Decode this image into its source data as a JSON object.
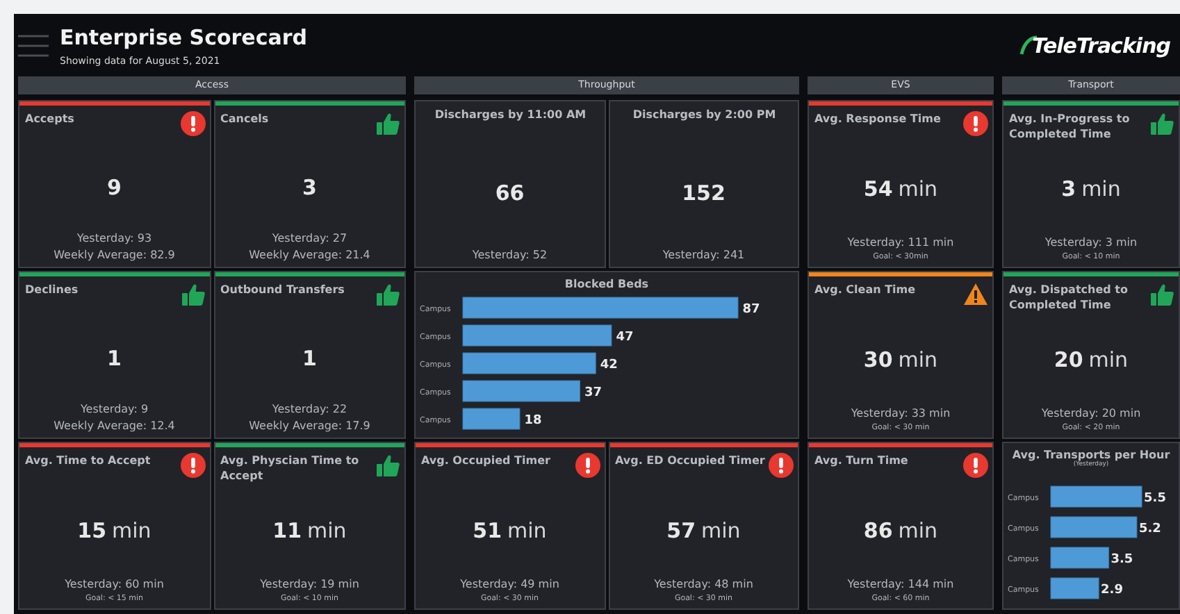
{
  "header": {
    "title": "Enterprise Scorecard",
    "subtitle": "Showing data for August 5, 2021",
    "logo": "TeleTracking"
  },
  "sections": [
    {
      "title": "Access",
      "cards": [
        {
          "kind": "kpi",
          "title": "Accepts",
          "color": "#e8382f",
          "value": "9",
          "lines": [
            {
              "kind": "main",
              "text": "Yesterday: 93"
            },
            {
              "kind": "main",
              "text": "Weekly Average: 82.9"
            }
          ]
        },
        {
          "kind": "kpi",
          "title": "Cancels",
          "color": "#21a559",
          "value": "3",
          "lines": [
            {
              "kind": "main",
              "text": "Yesterday: 27"
            },
            {
              "kind": "main",
              "text": "Weekly Average: 21.4"
            }
          ]
        },
        {
          "kind": "kpi",
          "title": "Declines",
          "color": "#21a559",
          "value": "1",
          "lines": [
            {
              "kind": "main",
              "text": "Yesterday: 9"
            },
            {
              "kind": "main",
              "text": "Weekly Average: 12.4"
            }
          ]
        },
        {
          "kind": "kpi",
          "title": "Outbound Transfers",
          "color": "#21a559",
          "value": "1",
          "lines": [
            {
              "kind": "main",
              "text": "Yesterday: 22"
            },
            {
              "kind": "main",
              "text": "Weekly Average: 17.9"
            }
          ]
        },
        {
          "kind": "kpi",
          "title": "Avg. Time to Accept",
          "color": "#e8382f",
          "value": "15",
          "unit": "min",
          "lines": [
            {
              "kind": "main",
              "text": "Yesterday: 60 min"
            },
            {
              "kind": "goal",
              "text": "Goal: < 15 min"
            }
          ]
        },
        {
          "kind": "kpi",
          "title": "Avg. Physcian Time to Accept",
          "color": "#21a559",
          "value": "11",
          "unit": "min",
          "lines": [
            {
              "kind": "main",
              "text": "Yesterday: 19 min"
            },
            {
              "kind": "goal",
              "text": "Goal: < 10 min"
            }
          ]
        }
      ]
    },
    {
      "title": "Throughput",
      "cards": [
        {
          "kind": "kpi",
          "title": "Discharges by 11:00 AM",
          "value": "66",
          "lines": [
            {
              "kind": "main",
              "text": "Yesterday: 52"
            }
          ]
        },
        {
          "kind": "kpi",
          "title": "Discharges by 2:00 PM",
          "value": "152",
          "lines": [
            {
              "kind": "main",
              "text": "Yesterday: 241"
            }
          ]
        },
        {
          "kind": "bar_chart",
          "chart_data": {
            "type": "bar",
            "orientation": "horizontal",
            "title": "Blocked Beds",
            "categories": [
              "Campus",
              "Campus",
              "Campus",
              "Campus",
              "Campus"
            ],
            "values": [
              87,
              47,
              42,
              37,
              18
            ],
            "data_labels": true
          }
        },
        {
          "kind": "kpi",
          "title": "Avg. Occupied Timer",
          "color": "#e8382f",
          "value": "51",
          "unit": "min",
          "lines": [
            {
              "kind": "main",
              "text": "Yesterday: 49 min"
            },
            {
              "kind": "goal",
              "text": "Goal: < 30 min"
            }
          ]
        },
        {
          "kind": "kpi",
          "title": "Avg. ED Occupied Timer",
          "color": "#e8382f",
          "value": "57",
          "unit": "min",
          "lines": [
            {
              "kind": "main",
              "text": "Yesterday: 48 min"
            },
            {
              "kind": "goal",
              "text": "Goal: < 30 min"
            }
          ]
        }
      ]
    },
    {
      "title": "EVS",
      "cards": [
        {
          "kind": "kpi",
          "title": "Avg. Response Time",
          "color": "#e8382f",
          "value": "54",
          "unit": "min",
          "lines": [
            {
              "kind": "main",
              "text": "Yesterday:  111 min"
            },
            {
              "kind": "goal",
              "text": "Goal: < 30min"
            }
          ]
        },
        {
          "kind": "kpi",
          "title": "Avg. Clean Time",
          "color": "#f0861c",
          "value": "30",
          "unit": "min",
          "lines": [
            {
              "kind": "main",
              "text": "Yesterday: 33 min"
            },
            {
              "kind": "goal",
              "text": "Goal: < 30 min"
            }
          ]
        },
        {
          "kind": "kpi",
          "title": "Avg. Turn Time",
          "color": "#e8382f",
          "value": "86",
          "unit": "min",
          "lines": [
            {
              "kind": "main",
              "text": "Yesterday: 144 min"
            },
            {
              "kind": "goal",
              "text": "Goal: < 60 min"
            }
          ]
        }
      ]
    },
    {
      "title": "Transport",
      "cards": [
        {
          "kind": "kpi",
          "title": "Avg. In-Progress to Completed Time",
          "color": "#21a559",
          "value": "3",
          "unit": "min",
          "lines": [
            {
              "kind": "main",
              "text": "Yesterday: 3 min"
            },
            {
              "kind": "goal",
              "text": "Goal: < 10 min"
            }
          ]
        },
        {
          "kind": "kpi",
          "title": "Avg. Dispatched to Completed Time",
          "color": "#21a559",
          "value": "20",
          "unit": "min",
          "lines": [
            {
              "kind": "main",
              "text": "Yesterday: 20 min"
            },
            {
              "kind": "goal",
              "text": "Goal: < 20 min"
            }
          ]
        },
        {
          "kind": "bar_chart",
          "subtitle": "(Yesterday)",
          "chart_data": {
            "type": "bar",
            "orientation": "horizontal",
            "title": "Avg. Transports per Hour",
            "categories": [
              "Campus",
              "Campus",
              "Campus",
              "Campus"
            ],
            "values": [
              5.5,
              5.2,
              3.5,
              2.9
            ],
            "data_labels": true
          }
        }
      ]
    }
  ]
}
